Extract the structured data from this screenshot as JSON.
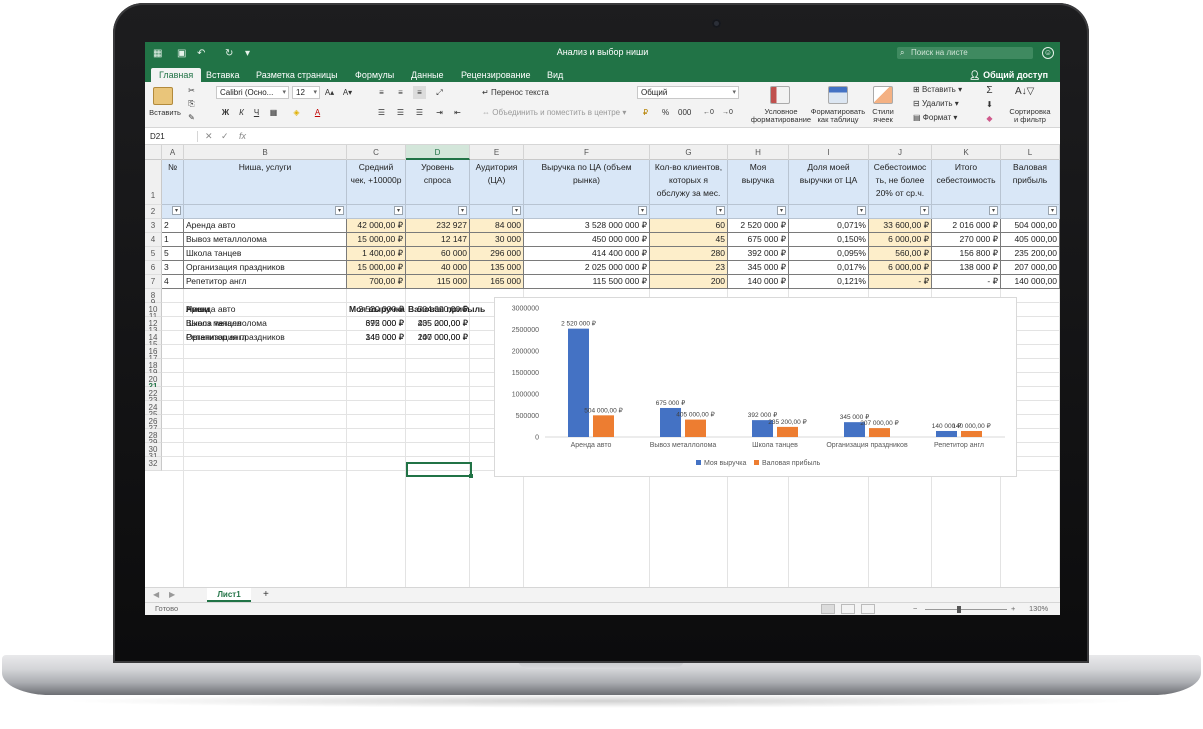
{
  "window": {
    "title": "Анализ и выбор ниши",
    "search_placeholder": "Поиск на листе",
    "share_label": "Общий доступ"
  },
  "tabs": [
    "Главная",
    "Вставка",
    "Разметка страницы",
    "Формулы",
    "Данные",
    "Рецензирование",
    "Вид"
  ],
  "ribbon": {
    "paste_label": "Вставить",
    "font_name": "Calibri (Осно...",
    "font_size": "12",
    "wrap_text": "Перенос текста",
    "merge_center": "Объединить и поместить в центре",
    "number_format": "Общий",
    "cond_format": [
      "Условное",
      "форматирование"
    ],
    "format_table": [
      "Форматировать",
      "как таблицу"
    ],
    "cell_styles": [
      "Стили",
      "ячеек"
    ],
    "insert_label": "Вставить",
    "delete_label": "Удалить",
    "format_label": "Формат",
    "sort_filter": [
      "Сортировка",
      "и фильтр"
    ]
  },
  "formula_bar": {
    "name_box": "D21",
    "fx": "fx"
  },
  "columns": [
    "A",
    "B",
    "C",
    "D",
    "E",
    "F",
    "G",
    "H",
    "I",
    "J",
    "K",
    "L"
  ],
  "selected_column": "D",
  "selected_row": "21",
  "row_numbers": [
    "1",
    "2",
    "3",
    "4",
    "5",
    "6",
    "7",
    "8",
    "9",
    "10",
    "11",
    "12",
    "13",
    "14",
    "15",
    "16",
    "17",
    "18",
    "19",
    "20",
    "21",
    "22",
    "23",
    "24",
    "25",
    "26",
    "27",
    "28",
    "29",
    "30",
    "31",
    "32"
  ],
  "table": {
    "headers": [
      [
        "№"
      ],
      [
        "Ниша, услуги"
      ],
      [
        "Средний",
        "чек, +10000р"
      ],
      [
        "Уровень",
        "спроса"
      ],
      [
        "Аудитория",
        "(ЦА)"
      ],
      [
        "Выручка по ЦА (объем",
        "рынка)"
      ],
      [
        "Кол-во клиентов,",
        "которых я",
        "обслужу за мес."
      ],
      [
        "Моя",
        "выручка"
      ],
      [
        "Доля моей",
        "выручки от ЦА"
      ],
      [
        "Себестоимос",
        "ть, не более",
        "20% от ср.ч."
      ],
      [
        "Итого",
        "себестоимость"
      ],
      [
        "Валовая",
        "прибыль"
      ]
    ],
    "rows": [
      [
        "2",
        "Аренда авто",
        "42 000,00 ₽",
        "232 927",
        "84 000",
        "3 528 000 000 ₽",
        "60",
        "2 520 000 ₽",
        "0,071%",
        "33 600,00 ₽",
        "2 016 000 ₽",
        "504 000,00"
      ],
      [
        "1",
        "Вывоз металлолома",
        "15 000,00 ₽",
        "12 147",
        "30 000",
        "450 000 000 ₽",
        "45",
        "675 000 ₽",
        "0,150%",
        "6 000,00 ₽",
        "270 000 ₽",
        "405 000,00"
      ],
      [
        "5",
        "Школа танцев",
        "1 400,00 ₽",
        "60 000",
        "296 000",
        "414 400 000 ₽",
        "280",
        "392 000 ₽",
        "0,095%",
        "560,00 ₽",
        "156 800 ₽",
        "235 200,00"
      ],
      [
        "3",
        "Организация праздников",
        "15 000,00 ₽",
        "40 000",
        "135 000",
        "2 025 000 000 ₽",
        "23",
        "345 000 ₽",
        "0,017%",
        "6 000,00 ₽",
        "138 000 ₽",
        "207 000,00"
      ],
      [
        "4",
        "Репетитор англ",
        "700,00 ₽",
        "115 000",
        "165 000",
        "115 500 000 ₽",
        "200",
        "140 000 ₽",
        "0,121%",
        "-   ₽",
        "-   ₽",
        "140 000,00"
      ]
    ]
  },
  "summary": {
    "headers": [
      "Ниши",
      "Моя выручка",
      "Валовая прибыль"
    ],
    "rows": [
      [
        "Аренда авто",
        "2 520 000 ₽",
        "504 000,00 ₽"
      ],
      [
        "Вывоз металлолома",
        "675 000 ₽",
        "405 000,00 ₽"
      ],
      [
        "Школа танцев",
        "392 000 ₽",
        "235 200,00 ₽"
      ],
      [
        "Организация праздников",
        "345 000 ₽",
        "207 000,00 ₽"
      ],
      [
        "Репетитор англ",
        "140 000 ₽",
        "140 000,00 ₽"
      ]
    ]
  },
  "chart_data": {
    "type": "bar",
    "categories": [
      "Аренда авто",
      "Вывоз металлолома",
      "Школа танцев",
      "Организация праздников",
      "Репетитор англ"
    ],
    "series": [
      {
        "name": "Моя выручка",
        "color": "#4472c4",
        "values": [
          2520000,
          675000,
          392000,
          345000,
          140000
        ],
        "labels": [
          "2 520 000 ₽",
          "675 000 ₽",
          "392 000 ₽",
          "345 000 ₽",
          "140 000 ₽"
        ]
      },
      {
        "name": "Валовая прибыль",
        "color": "#ed7d31",
        "values": [
          504000,
          405000,
          235200,
          207000,
          140000
        ],
        "labels": [
          "504 000,00 ₽",
          "405 000,00 ₽",
          "235 200,00 ₽",
          "207 000,00 ₽",
          "140 000,00 ₽"
        ]
      }
    ],
    "yticks": [
      "0",
      "500000",
      "1000000",
      "1500000",
      "2000000",
      "2500000",
      "3000000"
    ],
    "ylim": [
      0,
      3000000
    ],
    "grid": false,
    "legend": "bottom"
  },
  "sheets": {
    "active": "Лист1",
    "add": "+"
  },
  "status": {
    "ready": "Готово",
    "zoom": "130%"
  }
}
